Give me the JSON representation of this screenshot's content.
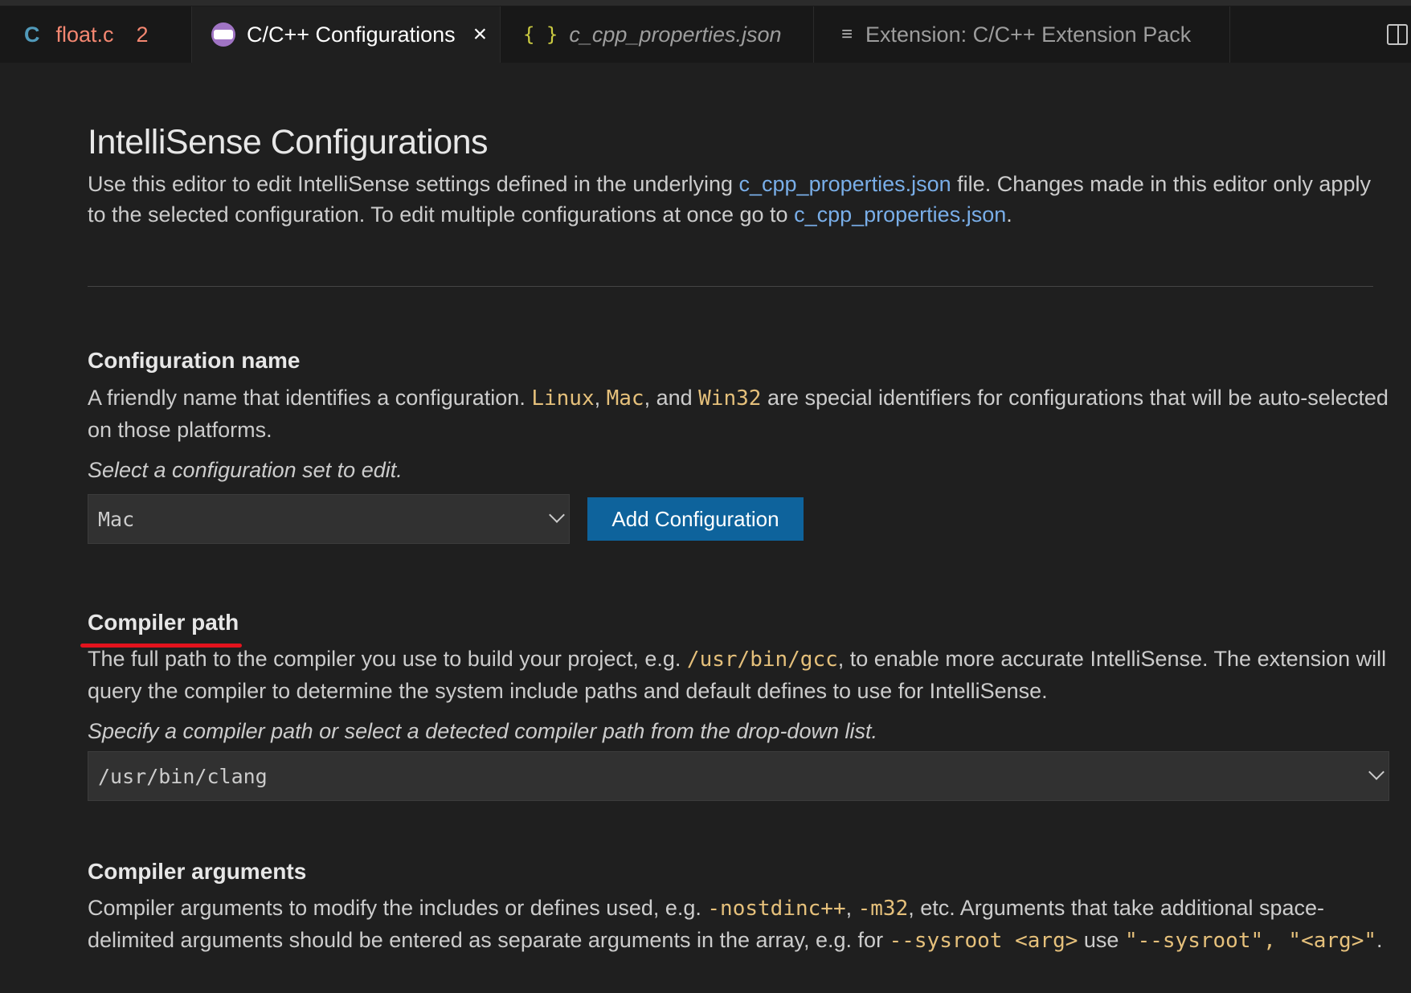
{
  "tabs": [
    {
      "lang": "C",
      "label": "float.c",
      "badge": "2"
    },
    {
      "label": "C/C++ Configurations",
      "close": "×"
    },
    {
      "icon_glyph": "{ }",
      "label": "c_cpp_properties.json"
    },
    {
      "label": "Extension: C/C++ Extension Pack"
    }
  ],
  "page": {
    "title": "IntelliSense Configurations",
    "intro": {
      "part1": "Use this editor to edit IntelliSense settings defined in the underlying ",
      "link1": "c_cpp_properties.json",
      "part2": " file. Changes made in this editor only apply to the selected configuration. To edit multiple configurations at once go to ",
      "link2": "c_cpp_properties.json",
      "part3": "."
    }
  },
  "config_name": {
    "heading": "Configuration name",
    "desc_a": "A friendly name that identifies a configuration. ",
    "code1": "Linux",
    "sep1": ", ",
    "code2": "Mac",
    "sep2": ", and ",
    "code3": "Win32",
    "desc_b": " are special identifiers for configurations that will be auto-selected on those platforms.",
    "hint": "Select a configuration set to edit.",
    "selected": "Mac",
    "add_button": "Add Configuration"
  },
  "compiler_path": {
    "heading": "Compiler path",
    "desc_a": "The full path to the compiler you use to build your project, e.g. ",
    "code1": "/usr/bin/gcc",
    "desc_b": ", to enable more accurate IntelliSense. The extension will query the compiler to determine the system include paths and default defines to use for IntelliSense.",
    "hint": "Specify a compiler path or select a detected compiler path from the drop-down list.",
    "value": "/usr/bin/clang"
  },
  "compiler_args": {
    "heading": "Compiler arguments",
    "desc_a": "Compiler arguments to modify the includes or defines used, e.g. ",
    "code1": "-nostdinc++",
    "sep1": ", ",
    "code2": "-m32",
    "desc_b": ", etc. Arguments that take additional space-delimited arguments should be entered as separate arguments in the array, e.g. for ",
    "code3": "--sysroot <arg>",
    "desc_c": " use ",
    "code4": "\"--sysroot\", \"<arg>\"",
    "desc_d": "."
  },
  "colors": {
    "background": "#1f1f1f",
    "link": "#79aee8",
    "code": "#e5c07b",
    "button": "#0e639c",
    "annotation_underline": "#e3131d"
  }
}
